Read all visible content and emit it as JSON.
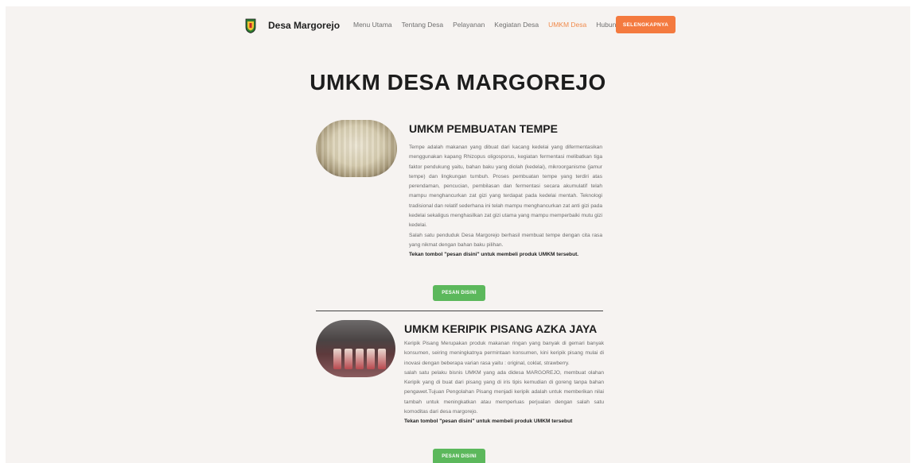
{
  "nav": {
    "brand": "Desa Margorejo",
    "items": [
      {
        "label": "Menu Utama",
        "active": false
      },
      {
        "label": "Tentang Desa",
        "active": false
      },
      {
        "label": "Pelayanan",
        "active": false
      },
      {
        "label": "Kegiatan Desa",
        "active": false
      },
      {
        "label": "UMKM Desa",
        "active": true
      },
      {
        "label": "Hubungi",
        "active": false
      }
    ],
    "cta_label": "SELENGKAPNYA"
  },
  "page_title": "UMKM DESA MARGOREJO",
  "sections": [
    {
      "title": "UMKM PEMBUATAN TEMPE",
      "paragraphs": [
        "Tempe adalah makanan yang dibuat dari kacang kedelai yang difermentasikan menggunakan kapang Rhizopus oligosporus, kegiatan fermentasi melibatkan tiga faktor pendukung yaitu, bahan baku yang diolah (kedelai), mikroorganisme (jamur tempe) dan lingkungan tumbuh. Proses pembuatan tempe yang terdiri atas perendaman, pencucian, pembilasan dan fermentasi secara akumulatif telah mampu menghancurkan zat gizi yang terdapat pada kedelai mentah. Teknologi tradisional dan relatif sederhana ini telah mampu menghancurkan zat anti gizi pada kedelai sekaligus menghasilkan zat gizi utama yang mampu memperbaiki mutu gizi kedelai.",
        "Salah satu penduduk Desa Margorejo berhasil membuat tempe dengan cita rasa yang nikmat dengan bahan baku pilihan."
      ],
      "instruction": "Tekan tombol \"pesan disini\" untuk membeli produk UMKM tersebut.",
      "button_label": "PESAN DISINI"
    },
    {
      "title": "UMKM KERIPIK PISANG AZKA JAYA",
      "paragraphs": [
        "Keripik Pisang Merupakan produk makanan ringan yang banyak di gemari banyak konsumen, seiring meningkatnya permintaan konsumen, kini keripik pisang mulai di inovasi dengan beberapa varian rasa yaitu : original, coklat, strawberry.",
        "salah satu pelaku bisnis UMKM yang ada didesa MARGOREJO, membuat olahan Keripik yang di buat dari pisang yang di iris tipis kemudian di goreng tanpa bahan pengawet.Tujuan Pengolahan Pisang menjadi keripik adalah untuk memberikan nilai tambah untuk meningkatkan atau memperluas perjualan dengan salah satu komoditas dari desa margorejo."
      ],
      "instruction": "Tekan tombol \"pesan disini\" untuk membeli produk UMKM tersebut",
      "button_label": "PESAN DISINI"
    }
  ],
  "colors": {
    "accent": "#f47a3f",
    "active_link": "#f08a4b",
    "order_button": "#5cb85c",
    "background": "#f6f3f1"
  }
}
